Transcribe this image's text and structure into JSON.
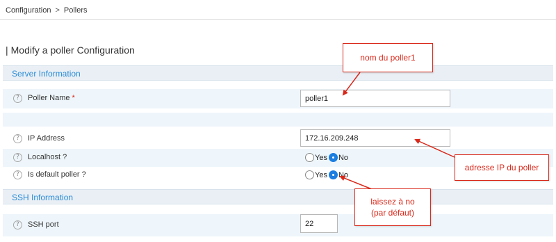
{
  "breadcrumb": {
    "root": "Configuration",
    "separator": ">",
    "current": "Pollers"
  },
  "page": {
    "title_bar": "|",
    "title": "Modify a poller Configuration"
  },
  "sections": {
    "server": {
      "label": "Server Information"
    },
    "ssh": {
      "label": "SSH Information"
    }
  },
  "fields": {
    "poller_name": {
      "label": "Poller Name",
      "required_marker": "*",
      "value": "poller1"
    },
    "ip_address": {
      "label": "IP Address",
      "value": "172.16.209.248"
    },
    "localhost": {
      "label": "Localhost ?",
      "yes": "Yes",
      "no": "No",
      "selected": "No"
    },
    "default_poller": {
      "label": "Is default poller ?",
      "yes": "Yes",
      "no": "No",
      "selected": "No"
    },
    "ssh_port": {
      "label": "SSH port",
      "value": "22"
    }
  },
  "help_icon_glyph": "?",
  "annotations": {
    "poller_name_note": "nom du poller1",
    "ip_note": "adresse IP du poller",
    "default_note_line1": "laissez à no",
    "default_note_line2": "(par défaut)"
  },
  "colors": {
    "annotation": "#d9281a",
    "section_text": "#2a8bd6",
    "radio_checked": "#1b7ee0"
  }
}
